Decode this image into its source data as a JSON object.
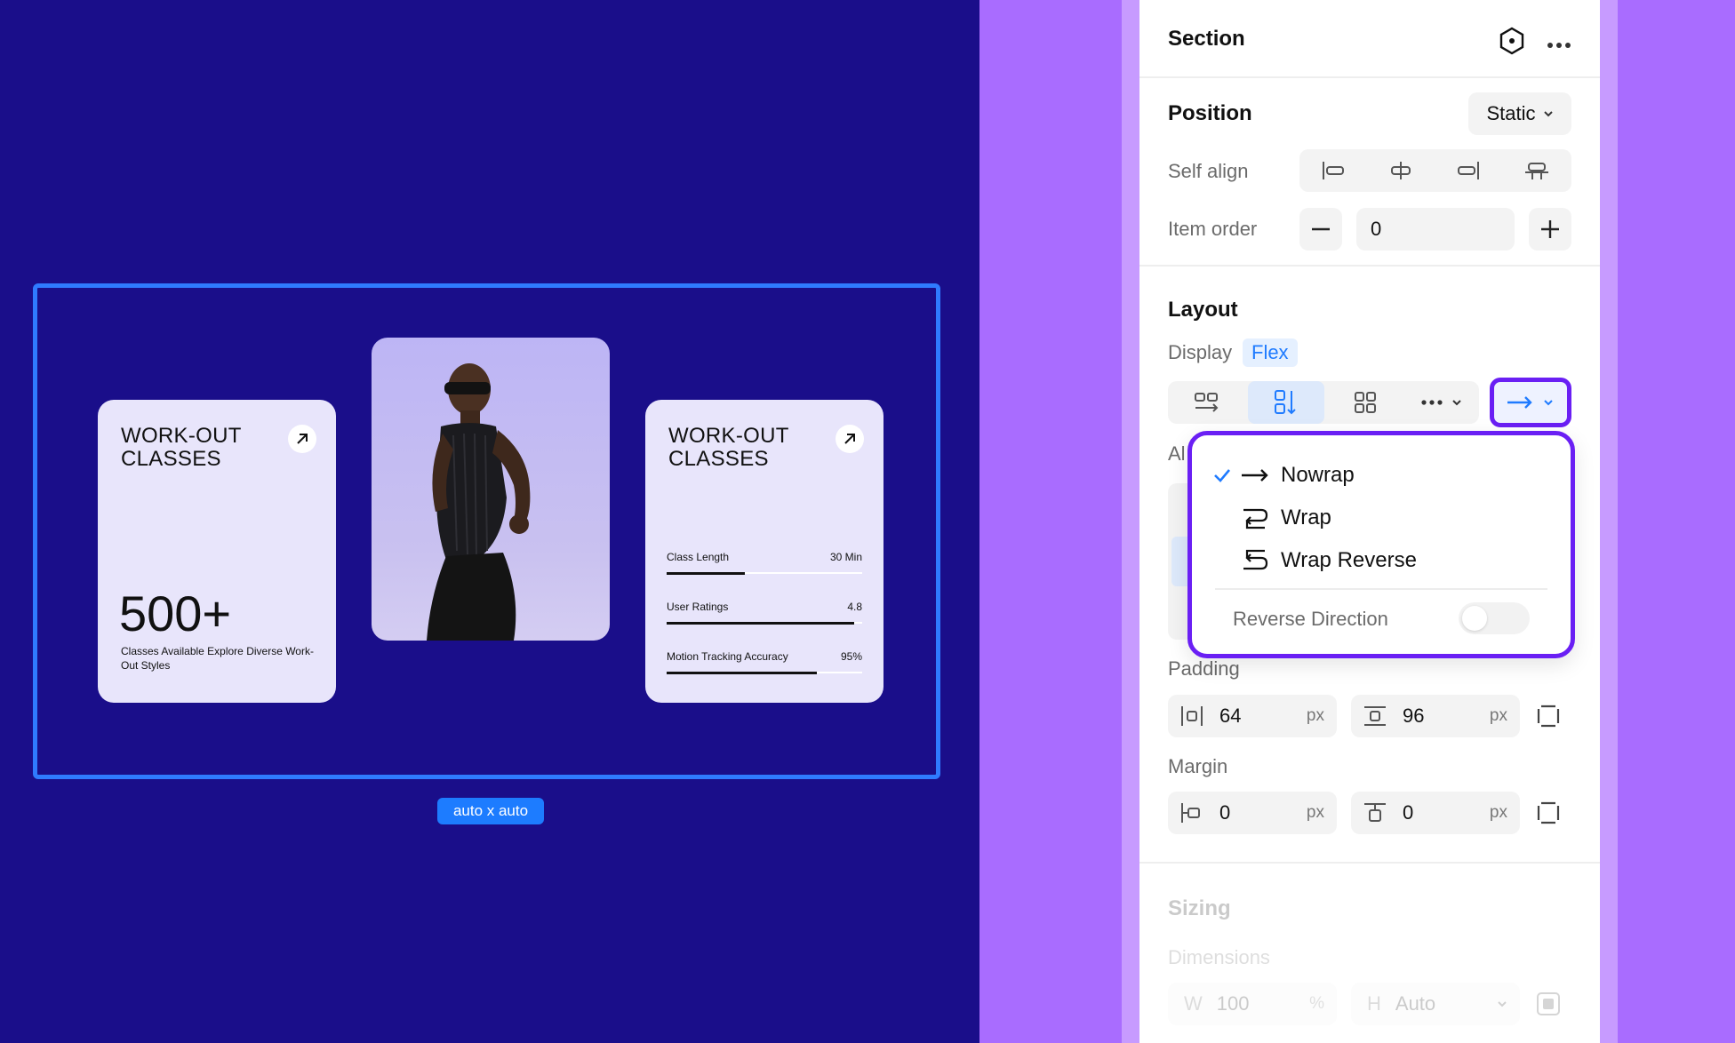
{
  "canvas": {
    "size_label": "auto x auto",
    "cards": [
      {
        "title": "WORK-OUT\nCLASSES",
        "big_number": "500+",
        "description": "Classes Available Explore Diverse Work-Out Styles"
      },
      {
        "title": "WORK-OUT\nCLASSES",
        "stats": [
          {
            "label": "Class Length",
            "value": "30 Min",
            "fill": 0.4
          },
          {
            "label": "User Ratings",
            "value": "4.8",
            "fill": 0.96
          },
          {
            "label": "Motion Tracking Accuracy",
            "value": "95%",
            "fill": 0.77
          }
        ]
      }
    ]
  },
  "panel": {
    "title": "Section",
    "position": {
      "heading": "Position",
      "value": "Static"
    },
    "self_align": {
      "label": "Self align"
    },
    "item_order": {
      "label": "Item order",
      "value": "0"
    },
    "layout": {
      "heading": "Layout",
      "display_label": "Display",
      "display_value": "Flex",
      "hidden_label_partial": "Al"
    },
    "padding": {
      "label": "Padding",
      "horizontal": "64",
      "vertical": "96",
      "unit": "px"
    },
    "margin": {
      "label": "Margin",
      "horizontal": "0",
      "vertical": "0",
      "unit": "px"
    },
    "sizing": {
      "heading": "Sizing",
      "dimensions_label": "Dimensions",
      "w_label": "W",
      "w_value": "100",
      "w_unit": "%",
      "h_label": "H",
      "h_value": "Auto"
    }
  },
  "wrap_menu": {
    "items": [
      {
        "label": "Nowrap",
        "checked": true
      },
      {
        "label": "Wrap",
        "checked": false
      },
      {
        "label": "Wrap Reverse",
        "checked": false
      }
    ],
    "reverse_label": "Reverse Direction",
    "reverse_on": false
  },
  "colors": {
    "canvas_bg": "#1a0e8a",
    "accent": "#1f7bff",
    "menu_border": "#6a1ff4",
    "page_bg": "#a96cff"
  }
}
